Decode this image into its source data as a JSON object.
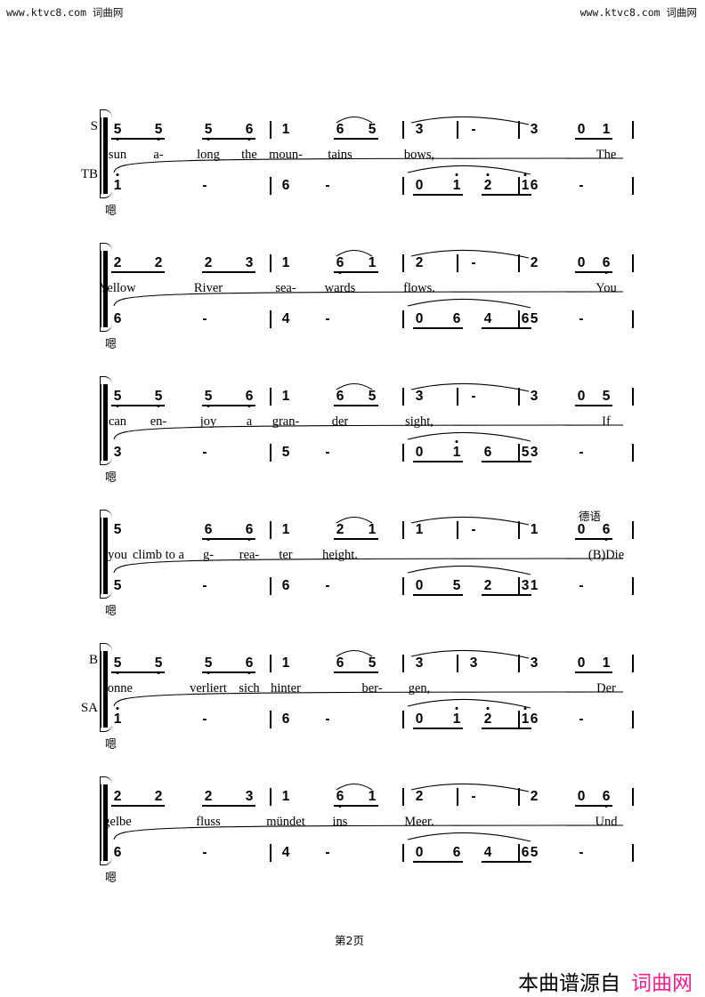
{
  "watermark": {
    "left": "www.ktvc8.com 词曲网",
    "right": "www.ktvc8.com 词曲网"
  },
  "footer": {
    "page_label": "第2页",
    "source_prefix": "本曲谱源自",
    "source_site": "词曲网",
    "source_color": "#ff1c8e"
  },
  "score": {
    "notation": "jianpu",
    "systems": [
      {
        "id": "system-1",
        "upper_voice_label": "S",
        "lower_voice_label": "TB",
        "hum_syllable": "嗯",
        "annotation": "",
        "upper_notes": [
          {
            "n": "5",
            "oct": "lo"
          },
          {
            "n": "5",
            "oct": "lo"
          },
          {
            "n": "5",
            "oct": "lo"
          },
          {
            "n": "6",
            "oct": "lo"
          },
          {
            "n": "1",
            "oct": ""
          },
          {
            "n": "6",
            "oct": ""
          },
          {
            "n": "5",
            "oct": ""
          },
          {
            "n": "3",
            "oct": ""
          },
          {
            "n": "-",
            "oct": ""
          },
          {
            "n": "3",
            "oct": ""
          },
          {
            "n": "0",
            "oct": ""
          },
          {
            "n": "1",
            "oct": ""
          }
        ],
        "lyrics": [
          "sun",
          "a-",
          "long",
          "the",
          "moun-",
          "tains",
          "",
          "bows,",
          "",
          "",
          "",
          "The"
        ],
        "lower_notes": [
          {
            "n": "1",
            "oct": "hi"
          },
          {
            "n": "-",
            "oct": ""
          },
          {
            "n": "6",
            "oct": ""
          },
          {
            "n": "-",
            "oct": ""
          },
          {
            "n": "0",
            "oct": ""
          },
          {
            "n": "1",
            "oct": "hi"
          },
          {
            "n": "2",
            "oct": "hi"
          },
          {
            "n": "1",
            "oct": "hi"
          },
          {
            "n": "6",
            "oct": ""
          },
          {
            "n": "-",
            "oct": ""
          }
        ]
      },
      {
        "id": "system-2",
        "upper_voice_label": "",
        "lower_voice_label": "",
        "hum_syllable": "嗯",
        "annotation": "",
        "upper_notes": [
          {
            "n": "2",
            "oct": ""
          },
          {
            "n": "2",
            "oct": ""
          },
          {
            "n": "2",
            "oct": ""
          },
          {
            "n": "3",
            "oct": ""
          },
          {
            "n": "1",
            "oct": ""
          },
          {
            "n": "6",
            "oct": "lo"
          },
          {
            "n": "1",
            "oct": ""
          },
          {
            "n": "2",
            "oct": ""
          },
          {
            "n": "-",
            "oct": ""
          },
          {
            "n": "2",
            "oct": ""
          },
          {
            "n": "0",
            "oct": ""
          },
          {
            "n": "6",
            "oct": "lo"
          }
        ],
        "lyrics": [
          "Yellow",
          "",
          "River",
          "",
          "sea-",
          "wards",
          "",
          "flows.",
          "",
          "",
          "",
          "You"
        ],
        "lower_notes": [
          {
            "n": "6",
            "oct": ""
          },
          {
            "n": "-",
            "oct": ""
          },
          {
            "n": "4",
            "oct": ""
          },
          {
            "n": "-",
            "oct": ""
          },
          {
            "n": "0",
            "oct": ""
          },
          {
            "n": "6",
            "oct": ""
          },
          {
            "n": "4",
            "oct": ""
          },
          {
            "n": "6",
            "oct": ""
          },
          {
            "n": "5",
            "oct": ""
          },
          {
            "n": "-",
            "oct": ""
          }
        ]
      },
      {
        "id": "system-3",
        "upper_voice_label": "",
        "lower_voice_label": "",
        "hum_syllable": "嗯",
        "annotation": "",
        "upper_notes": [
          {
            "n": "5",
            "oct": "lo"
          },
          {
            "n": "5",
            "oct": "lo"
          },
          {
            "n": "5",
            "oct": "lo"
          },
          {
            "n": "6",
            "oct": "lo"
          },
          {
            "n": "1",
            "oct": ""
          },
          {
            "n": "6",
            "oct": ""
          },
          {
            "n": "5",
            "oct": ""
          },
          {
            "n": "3",
            "oct": ""
          },
          {
            "n": "-",
            "oct": ""
          },
          {
            "n": "3",
            "oct": ""
          },
          {
            "n": "0",
            "oct": ""
          },
          {
            "n": "5",
            "oct": ""
          }
        ],
        "lyrics": [
          "can",
          "en-",
          "joy",
          "a",
          "gran-",
          "der",
          "",
          "sight,",
          "",
          "",
          "",
          "If"
        ],
        "lower_notes": [
          {
            "n": "3",
            "oct": ""
          },
          {
            "n": "-",
            "oct": ""
          },
          {
            "n": "5",
            "oct": ""
          },
          {
            "n": "-",
            "oct": ""
          },
          {
            "n": "0",
            "oct": ""
          },
          {
            "n": "1",
            "oct": "hi"
          },
          {
            "n": "6",
            "oct": ""
          },
          {
            "n": "5",
            "oct": ""
          },
          {
            "n": "3",
            "oct": ""
          },
          {
            "n": "-",
            "oct": ""
          }
        ]
      },
      {
        "id": "system-4",
        "upper_voice_label": "",
        "lower_voice_label": "",
        "hum_syllable": "嗯",
        "annotation": "德语",
        "upper_notes": [
          {
            "n": "5",
            "oct": ""
          },
          {
            "n": "",
            "oct": ""
          },
          {
            "n": "6",
            "oct": "lo"
          },
          {
            "n": "6",
            "oct": "lo"
          },
          {
            "n": "1",
            "oct": ""
          },
          {
            "n": "2",
            "oct": ""
          },
          {
            "n": "1",
            "oct": ""
          },
          {
            "n": "1",
            "oct": ""
          },
          {
            "n": "-",
            "oct": ""
          },
          {
            "n": "1",
            "oct": ""
          },
          {
            "n": "0",
            "oct": ""
          },
          {
            "n": "6",
            "oct": "lo"
          }
        ],
        "lyrics": [
          "you",
          "climb to a",
          "g-",
          "rea-",
          "ter",
          "height.",
          "",
          "",
          "",
          "",
          "",
          "(B)Die"
        ],
        "lower_notes": [
          {
            "n": "5",
            "oct": ""
          },
          {
            "n": "-",
            "oct": ""
          },
          {
            "n": "6",
            "oct": ""
          },
          {
            "n": "-",
            "oct": ""
          },
          {
            "n": "0",
            "oct": ""
          },
          {
            "n": "5",
            "oct": ""
          },
          {
            "n": "2",
            "oct": ""
          },
          {
            "n": "3",
            "oct": ""
          },
          {
            "n": "1",
            "oct": ""
          },
          {
            "n": "-",
            "oct": ""
          }
        ]
      },
      {
        "id": "system-5",
        "upper_voice_label": "B",
        "lower_voice_label": "SA",
        "hum_syllable": "嗯",
        "annotation": "",
        "upper_notes": [
          {
            "n": "5",
            "oct": "lo"
          },
          {
            "n": "5",
            "oct": "lo"
          },
          {
            "n": "5",
            "oct": "lo"
          },
          {
            "n": "6",
            "oct": "lo"
          },
          {
            "n": "1",
            "oct": ""
          },
          {
            "n": "6",
            "oct": ""
          },
          {
            "n": "5",
            "oct": ""
          },
          {
            "n": "3",
            "oct": ""
          },
          {
            "n": "3",
            "oct": ""
          },
          {
            "n": "3",
            "oct": ""
          },
          {
            "n": "0",
            "oct": ""
          },
          {
            "n": "1",
            "oct": ""
          }
        ],
        "lyrics": [
          "sonne",
          "",
          "verliert",
          "sich",
          "hinter",
          "",
          "ber-",
          "gen,",
          "",
          "",
          "",
          "Der"
        ],
        "lower_notes": [
          {
            "n": "1",
            "oct": "hi"
          },
          {
            "n": "-",
            "oct": ""
          },
          {
            "n": "6",
            "oct": ""
          },
          {
            "n": "-",
            "oct": ""
          },
          {
            "n": "0",
            "oct": ""
          },
          {
            "n": "1",
            "oct": "hi"
          },
          {
            "n": "2",
            "oct": "hi"
          },
          {
            "n": "1",
            "oct": "hi"
          },
          {
            "n": "6",
            "oct": ""
          },
          {
            "n": "-",
            "oct": ""
          }
        ]
      },
      {
        "id": "system-6",
        "upper_voice_label": "",
        "lower_voice_label": "",
        "hum_syllable": "嗯",
        "annotation": "",
        "upper_notes": [
          {
            "n": "2",
            "oct": ""
          },
          {
            "n": "2",
            "oct": ""
          },
          {
            "n": "2",
            "oct": ""
          },
          {
            "n": "3",
            "oct": ""
          },
          {
            "n": "1",
            "oct": ""
          },
          {
            "n": "6",
            "oct": "lo"
          },
          {
            "n": "1",
            "oct": ""
          },
          {
            "n": "2",
            "oct": ""
          },
          {
            "n": "-",
            "oct": ""
          },
          {
            "n": "2",
            "oct": ""
          },
          {
            "n": "0",
            "oct": ""
          },
          {
            "n": "6",
            "oct": "lo"
          }
        ],
        "lyrics": [
          "gelbe",
          "",
          "fluss",
          "",
          "mündet",
          "ins",
          "",
          "Meer.",
          "",
          "",
          "",
          "Und"
        ],
        "lower_notes": [
          {
            "n": "6",
            "oct": ""
          },
          {
            "n": "-",
            "oct": ""
          },
          {
            "n": "4",
            "oct": ""
          },
          {
            "n": "-",
            "oct": ""
          },
          {
            "n": "0",
            "oct": ""
          },
          {
            "n": "6",
            "oct": ""
          },
          {
            "n": "4",
            "oct": ""
          },
          {
            "n": "6",
            "oct": ""
          },
          {
            "n": "5",
            "oct": ""
          },
          {
            "n": "-",
            "oct": ""
          }
        ]
      }
    ]
  }
}
